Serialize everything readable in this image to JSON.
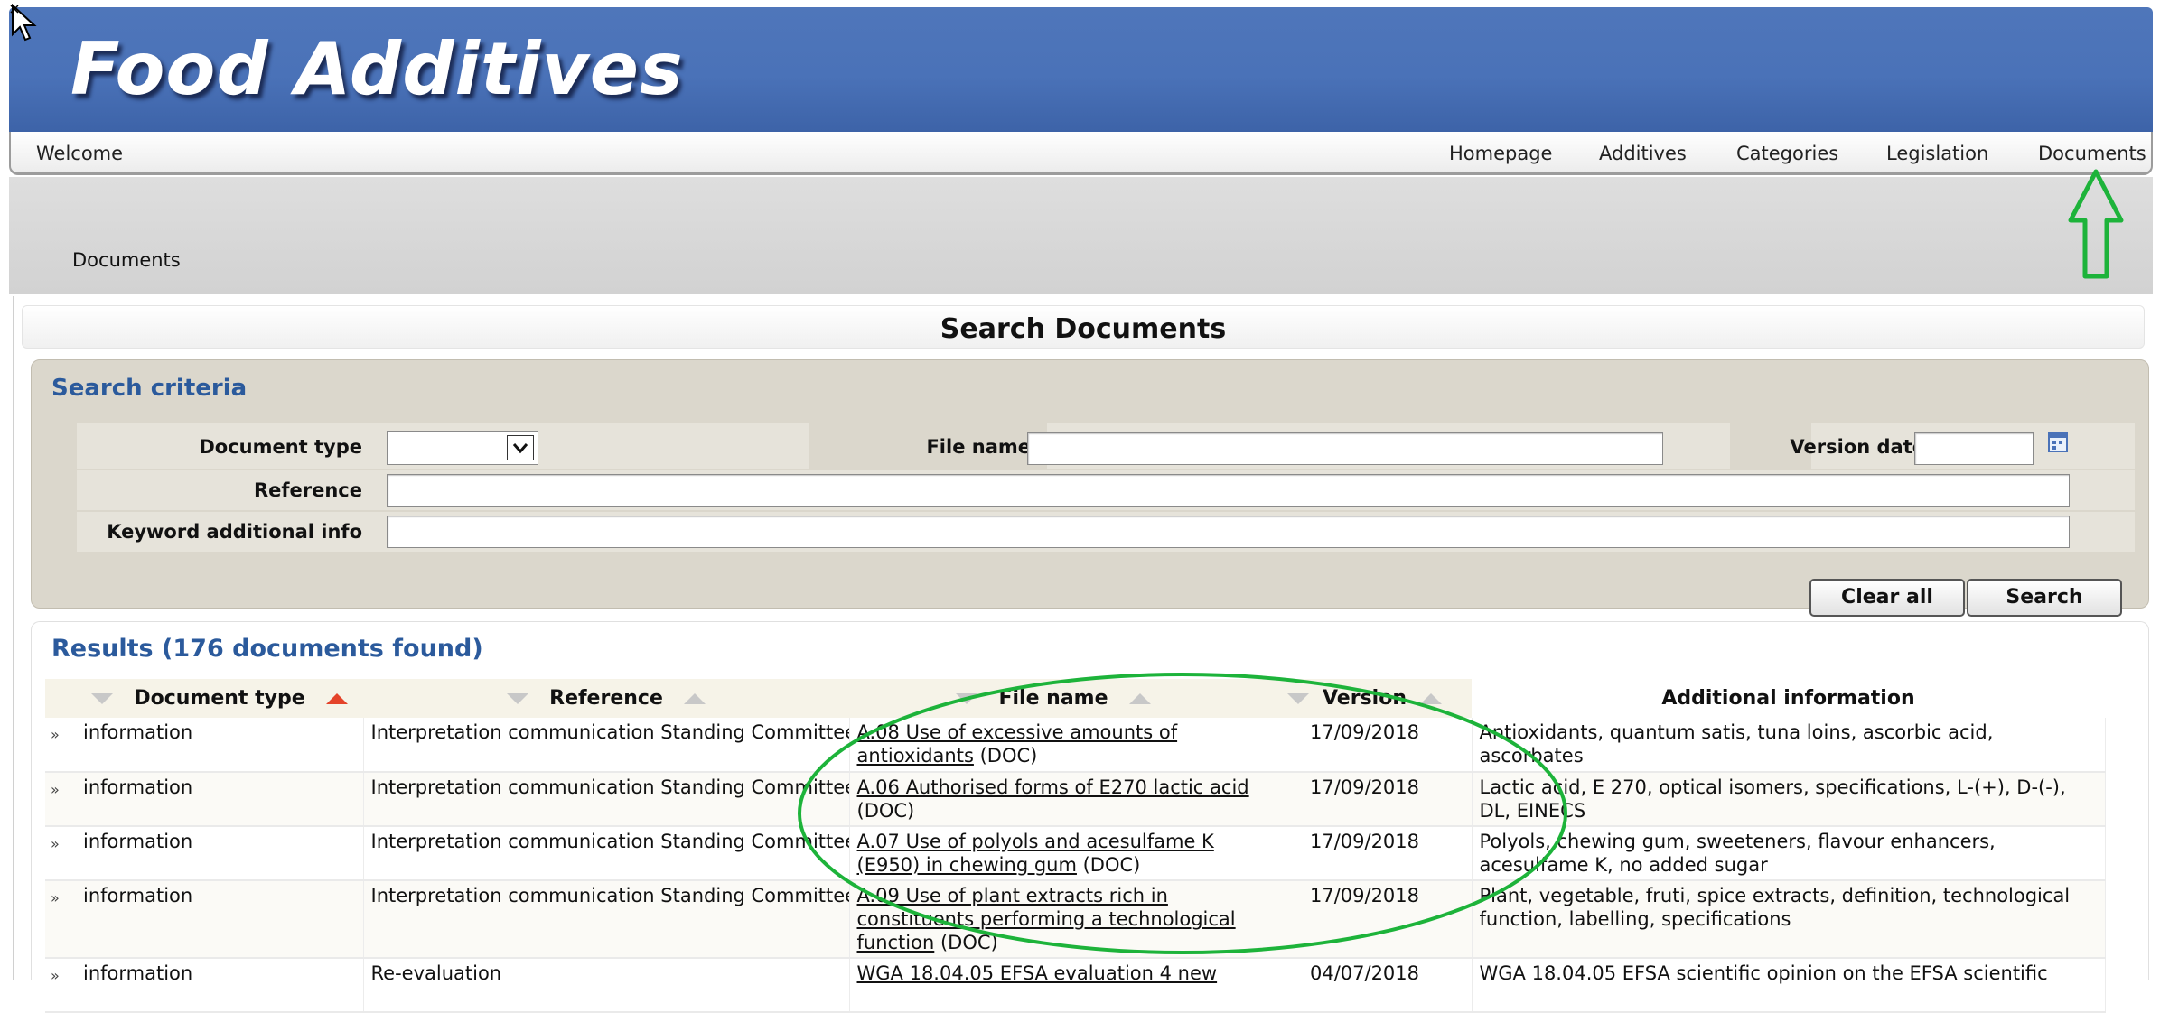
{
  "app": {
    "title": "Food Additives"
  },
  "nav": {
    "welcome": "Welcome",
    "links": [
      "Homepage",
      "Additives",
      "Categories",
      "Legislation",
      "Documents"
    ]
  },
  "breadcrumb": "Documents",
  "search": {
    "page_title": "Search Documents",
    "criteria_title": "Search criteria",
    "labels": {
      "document_type": "Document type",
      "file_name": "File name",
      "version_date": "Version date",
      "reference": "Reference",
      "keyword": "Keyword additional info"
    },
    "values": {
      "document_type": "",
      "file_name": "",
      "version_date": "",
      "reference": "",
      "keyword": ""
    },
    "buttons": {
      "clear": "Clear all",
      "search": "Search"
    }
  },
  "results": {
    "title": "Results (176 documents found)",
    "columns": [
      "Document type",
      "Reference",
      "File name",
      "Version",
      "Additional information"
    ],
    "rows": [
      {
        "expand": "»",
        "doc_type": "information",
        "reference": "Interpretation communication Standing Committee",
        "file_link": "A.08 Use of excessive amounts of antioxidants",
        "file_suffix": " (DOC)",
        "version": "17/09/2018",
        "info": "Antioxidants, quantum satis, tuna loins, ascorbic acid, ascorbates"
      },
      {
        "expand": "»",
        "doc_type": "information",
        "reference": "Interpretation communication Standing Committee",
        "file_link": "A.06 Authorised forms of E270 lactic acid",
        "file_suffix": " (DOC)",
        "version": "17/09/2018",
        "info": "Lactic acid, E 270, optical isomers, specifications, L-(+), D-(-), DL, EINECS"
      },
      {
        "expand": "»",
        "doc_type": "information",
        "reference": "Interpretation communication Standing Committee",
        "file_link": "A.07 Use of polyols and acesulfame K (E950) in chewing gum",
        "file_suffix": " (DOC)",
        "version": "17/09/2018",
        "info": "Polyols, chewing gum, sweeteners, flavour enhancers, acesulfame K, no added sugar"
      },
      {
        "expand": "»",
        "doc_type": "information",
        "reference": "Interpretation communication Standing Committee",
        "file_link": "A.09 Use of plant extracts rich in constituents performing a technological function",
        "file_suffix": " (DOC)",
        "version": "17/09/2018",
        "info": "Plant, vegetable, fruti, spice extracts, definition, technological function, labelling, specifications"
      },
      {
        "expand": "»",
        "doc_type": "information",
        "reference": "Re-evaluation",
        "file_link": "WGA 18.04.05 EFSA evaluation 4 new",
        "file_suffix": "",
        "version": "04/07/2018",
        "info": "WGA 18.04.05 EFSA scientific opinion on the EFSA scientific"
      }
    ]
  },
  "colors": {
    "banner": "#4a72b8",
    "accent_title": "#2b5a9c",
    "annotation_green": "#1db33a",
    "sort_active": "#e4432a",
    "panel_bg": "#dbd7cc"
  }
}
